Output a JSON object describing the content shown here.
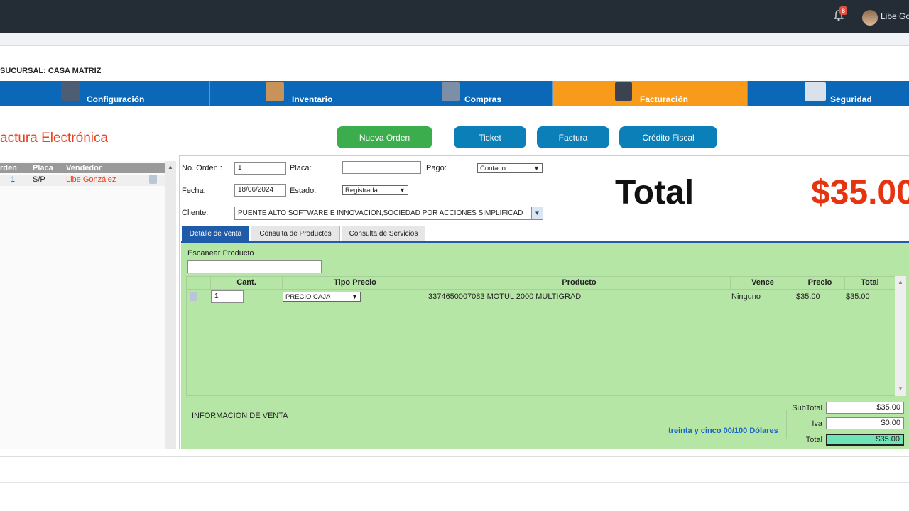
{
  "header": {
    "notification_count": "8",
    "user_name": "Libe Go"
  },
  "branch_label": "SUCURSAL: CASA MATRIZ",
  "menu": {
    "items": [
      {
        "label": "Configuración"
      },
      {
        "label": "Inventario"
      },
      {
        "label": "Compras"
      },
      {
        "label": "Facturación"
      },
      {
        "label": "Seguridad"
      }
    ],
    "active": "Facturación",
    "active_color": "#f89b1b",
    "bar_color": "#0b67b8"
  },
  "page_title": "actura Electrónica",
  "actions": {
    "new_order": "Nueva Orden",
    "ticket": "Ticket",
    "invoice": "Factura",
    "fiscal_credit": "Crédito Fiscal"
  },
  "orders": {
    "headers": [
      "rden",
      "Placa",
      "Vendedor"
    ],
    "rows": [
      {
        "order": "1",
        "plate": "S/P",
        "seller": "Libe González"
      }
    ]
  },
  "form": {
    "order_label": "No. Orden :",
    "order_value": "1",
    "plate_label": "Placa:",
    "plate_value": "",
    "payment_label": "Pago:",
    "payment_value": "Contado",
    "date_label": "Fecha:",
    "date_value": "18/06/2024",
    "status_label": "Estado:",
    "status_value": "Registrada",
    "client_label": "Cliente:",
    "client_value": "PUENTE ALTO SOFTWARE E INNOVACION,SOCIEDAD POR ACCIONES SIMPLIFICAD"
  },
  "total": {
    "label": "Total",
    "amount": "$35.00"
  },
  "tabs": [
    "Detalle de Venta",
    "Consulta de Productos",
    "Consulta de Servicios"
  ],
  "scan_label": "Escanear Producto",
  "items_table": {
    "headers": [
      "Cant.",
      "Tipo Precio",
      "Producto",
      "Vence",
      "Precio",
      "Total"
    ],
    "rows": [
      {
        "qty": "1",
        "price_type": "PRECIO CAJA",
        "product": "3374650007083 MOTUL 2000 MULTIGRAD",
        "expires": "Ninguno",
        "price": "$35.00",
        "total": "$35.00"
      }
    ]
  },
  "info": {
    "title": "INFORMACION DE VENTA",
    "amount_words": "treinta y cinco 00/100 Dólares"
  },
  "summary": {
    "subtotal_label": "SubTotal",
    "subtotal": "$35.00",
    "tax_label": "Iva",
    "tax": "$0.00",
    "total_label": "Total",
    "total": "$35.00"
  }
}
